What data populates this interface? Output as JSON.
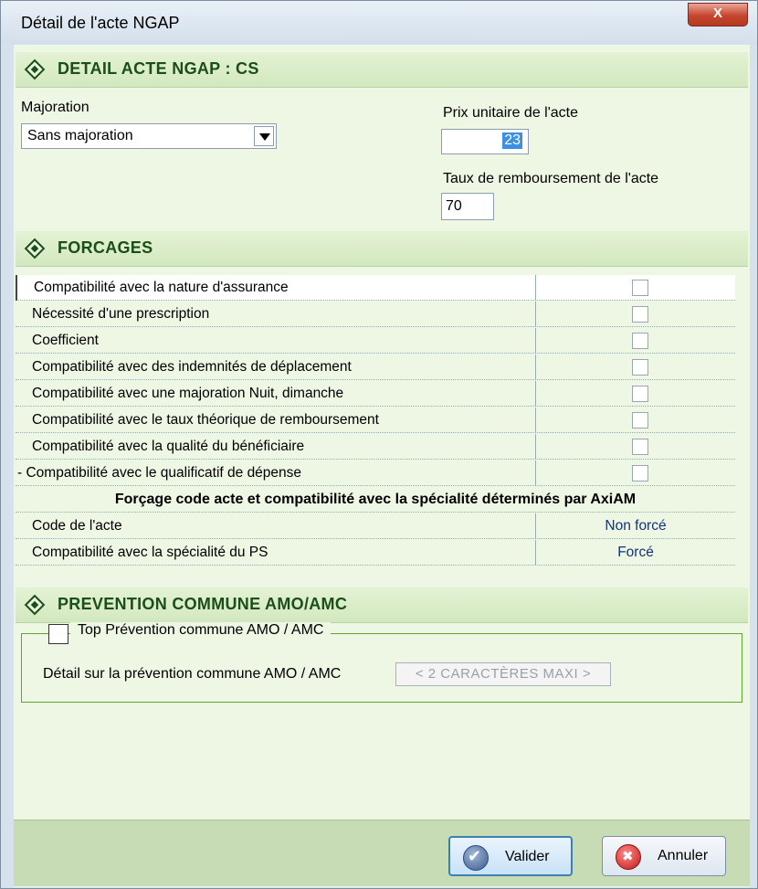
{
  "window": {
    "title": "Détail de l'acte NGAP",
    "close_label": "X"
  },
  "section_detail": {
    "title": "DETAIL ACTE NGAP : CS"
  },
  "majoration": {
    "label": "Majoration",
    "value": "Sans majoration"
  },
  "prix": {
    "label": "Prix unitaire de l'acte",
    "value": "23"
  },
  "taux": {
    "label": "Taux de remboursement de l'acte",
    "value": "70"
  },
  "section_forcages": {
    "title": "FORCAGES"
  },
  "forcages": {
    "rows": [
      "Compatibilité avec la nature d'assurance",
      "Nécessité d'une prescription",
      "Coefficient",
      "Compatibilité avec des indemnités de déplacement",
      "Compatibilité avec une majoration Nuit, dimanche",
      "Compatibilité avec le taux théorique de remboursement",
      "Compatibilité avec la qualité du bénéficiaire",
      "- Compatibilité avec le qualificatif de dépense"
    ],
    "subheader": "Forçage code acte et compatibilité avec la spécialité déterminés par AxiAM",
    "code_label": "Code de l'acte",
    "code_value": "Non forcé",
    "spec_label": "Compatibilité avec la spécialité du PS",
    "spec_value": "Forcé"
  },
  "section_prevention": {
    "title": "PREVENTION COMMUNE AMO/AMC"
  },
  "prevention": {
    "top_label": "Top Prévention commune AMO / AMC",
    "detail_label": "Détail sur la prévention commune AMO / AMC",
    "detail_placeholder": "< 2 CARACTÈRES  MAXI >"
  },
  "buttons": {
    "valider": "Valider",
    "annuler": "Annuler"
  }
}
